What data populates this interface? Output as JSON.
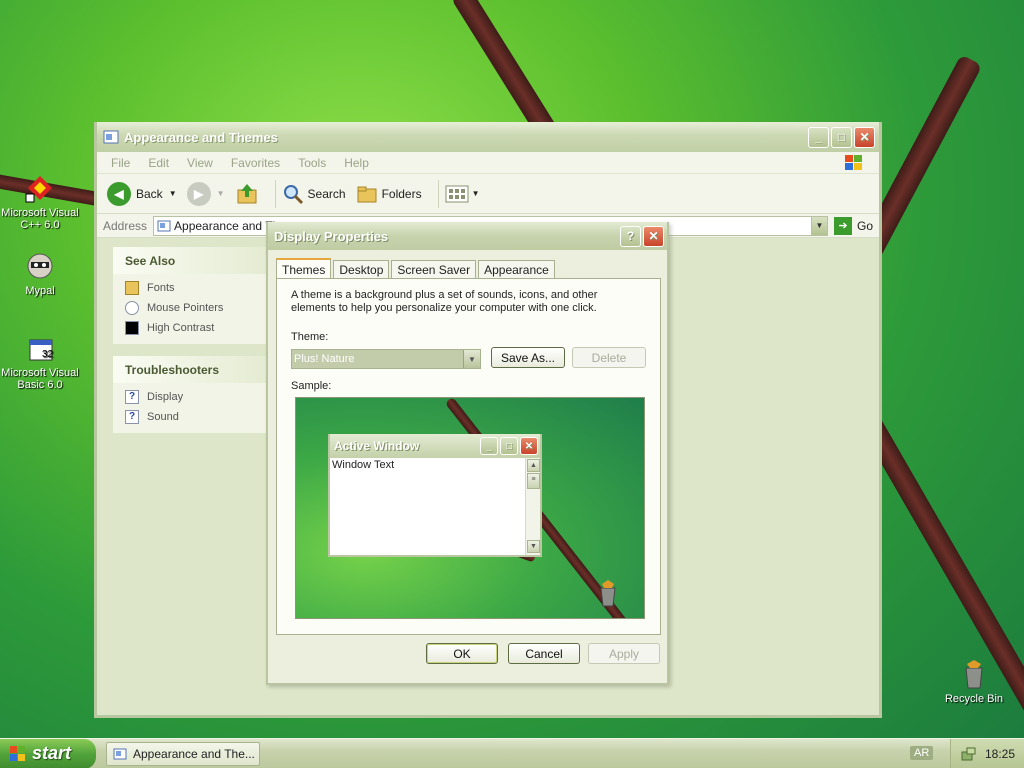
{
  "desktop": {
    "icons": [
      {
        "label": "Microsoft Visual C++ 6.0"
      },
      {
        "label": "Mypal"
      },
      {
        "label": "Microsoft Visual Basic 6.0"
      },
      {
        "label": "Recycle Bin"
      }
    ]
  },
  "explorer": {
    "title": "Appearance and Themes",
    "menu": [
      "File",
      "Edit",
      "View",
      "Favorites",
      "Tools",
      "Help"
    ],
    "toolbar": {
      "back": "Back",
      "search": "Search",
      "folders": "Folders"
    },
    "address_label": "Address",
    "address_value": "Appearance and Themes",
    "go": "Go",
    "see_also": {
      "title": "See Also",
      "items": [
        "Fonts",
        "Mouse Pointers",
        "High Contrast"
      ]
    },
    "troubleshooters": {
      "title": "Troubleshooters",
      "items": [
        "Display",
        "Sound"
      ]
    }
  },
  "dialog": {
    "title": "Display Properties",
    "tabs": [
      "Themes",
      "Desktop",
      "Screen Saver",
      "Appearance"
    ],
    "description": "A theme is a background plus a set of sounds, icons, and other elements to help you personalize your computer with one click.",
    "theme_label": "Theme:",
    "theme_value": "Plus! Nature",
    "save_as": "Save As...",
    "delete": "Delete",
    "sample_label": "Sample:",
    "sample_window_title": "Active Window",
    "sample_window_text": "Window Text",
    "ok": "OK",
    "cancel": "Cancel",
    "apply": "Apply"
  },
  "taskbar": {
    "start": "start",
    "task": "Appearance and The...",
    "language": "AR",
    "clock": "18:25"
  },
  "colors": {
    "title_bar": "#c6d3ad",
    "start_button": "#52a33b",
    "close_button": "#c8432a"
  }
}
